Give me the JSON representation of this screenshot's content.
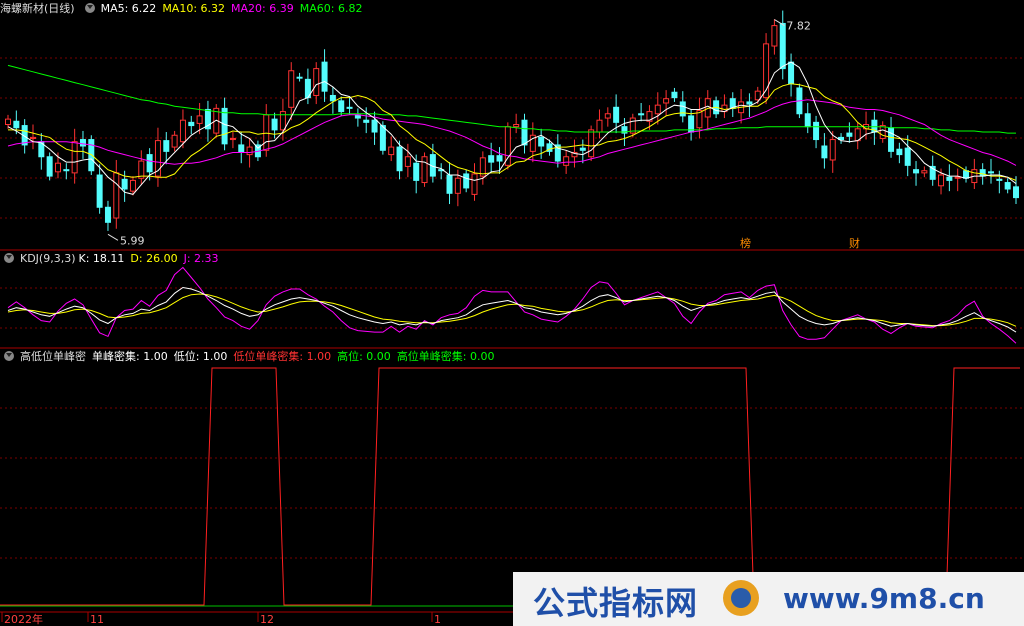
{
  "colors": {
    "up": "#ff3232",
    "down": "#54fcfc",
    "ma5": "#ffffff",
    "ma10": "#ffff00",
    "ma20": "#ff00ff",
    "ma60": "#00ff00",
    "k": "#ffffff",
    "d": "#ffff00",
    "j": "#ff00ff",
    "grid": "#7a0000",
    "signal": "#ff2020",
    "base": "#00c000"
  },
  "main": {
    "title": "海螺新材(日线)",
    "ma": [
      {
        "label": "MA5: 6.22",
        "color": "#ffffff"
      },
      {
        "label": "MA10: 6.32",
        "color": "#ffff00"
      },
      {
        "label": "MA20: 6.39",
        "color": "#ff00ff"
      },
      {
        "label": "MA60: 6.82",
        "color": "#00ff00"
      }
    ],
    "high_label": "7.82",
    "low_label": "5.99",
    "badge1": "榜",
    "badge2": "财"
  },
  "kdj": {
    "title": "KDJ(9,3,3)",
    "items": [
      {
        "label": "K: 18.11",
        "color": "#ffffff"
      },
      {
        "label": "D: 26.00",
        "color": "#ffff00"
      },
      {
        "label": "J: 2.33",
        "color": "#ff00ff"
      }
    ]
  },
  "ind": {
    "title": "高低位单峰密",
    "items": [
      {
        "label": "单峰密集: 1.00",
        "color": "#ffffff"
      },
      {
        "label": "低位: 1.00",
        "color": "#ffffff"
      },
      {
        "label": "低位单峰密集: 1.00",
        "color": "#ff3232"
      },
      {
        "label": "高位: 0.00",
        "color": "#00ff00"
      },
      {
        "label": "高位单峰密集: 0.00",
        "color": "#00ff00"
      }
    ]
  },
  "xaxis": {
    "labels": [
      "2022年",
      "11",
      "12",
      "1"
    ]
  },
  "watermark": {
    "text1": "公式指标网",
    "text2": "www.9m8.cn"
  },
  "chart_data": {
    "type": "candlestick",
    "price_range": [
      5.9,
      7.9
    ],
    "close": [
      6.95,
      6.87,
      6.71,
      6.78,
      6.6,
      6.42,
      6.54,
      6.47,
      6.74,
      6.7,
      6.47,
      6.13,
      5.99,
      6.45,
      6.3,
      6.38,
      6.56,
      6.46,
      6.75,
      6.65,
      6.8,
      6.94,
      6.89,
      6.98,
      6.86,
      7.05,
      6.72,
      6.77,
      6.64,
      6.69,
      6.6,
      6.99,
      6.85,
      7.02,
      7.4,
      7.34,
      7.15,
      7.42,
      7.21,
      7.12,
      7.02,
      7.05,
      6.96,
      6.92,
      6.83,
      6.66,
      6.69,
      6.47,
      6.6,
      6.38,
      6.6,
      6.42,
      6.47,
      6.26,
      6.4,
      6.31,
      6.44,
      6.59,
      6.55,
      6.56,
      6.88,
      6.9,
      6.71,
      6.8,
      6.7,
      6.65,
      6.56,
      6.6,
      6.64,
      6.66,
      6.85,
      6.94,
      7.0,
      6.92,
      6.82,
      6.96,
      6.99,
      7.02,
      7.08,
      7.14,
      7.15,
      6.98,
      6.83,
      7.03,
      7.14,
      7.0,
      7.08,
      7.05,
      7.11,
      7.09,
      7.21,
      7.65,
      7.82,
      7.42,
      7.28,
      7.0,
      6.88,
      6.76,
      6.59,
      6.76,
      6.76,
      6.79,
      6.86,
      6.9,
      6.83,
      6.89,
      6.65,
      6.62,
      6.52,
      6.45,
      6.47,
      6.39,
      6.43,
      6.38,
      6.41,
      6.4,
      6.48,
      6.42,
      6.45,
      6.38,
      6.3,
      6.22
    ],
    "ma5": [
      6.88,
      6.84,
      6.79,
      6.74,
      6.73,
      6.67,
      6.6,
      6.55,
      6.55,
      6.57,
      6.58,
      6.5,
      6.41,
      6.35,
      6.27,
      6.25,
      6.34,
      6.43,
      6.47,
      6.56,
      6.64,
      6.72,
      6.8,
      6.85,
      6.89,
      6.94,
      6.9,
      6.88,
      6.81,
      6.77,
      6.68,
      6.74,
      6.75,
      6.83,
      6.97,
      7.12,
      7.15,
      7.27,
      7.3,
      7.25,
      7.18,
      7.16,
      7.07,
      7.01,
      6.96,
      6.88,
      6.81,
      6.71,
      6.65,
      6.56,
      6.55,
      6.51,
      6.49,
      6.43,
      6.43,
      6.4,
      6.38,
      6.4,
      6.46,
      6.47,
      6.59,
      6.69,
      6.72,
      6.77,
      6.8,
      6.75,
      6.68,
      6.66,
      6.63,
      6.62,
      6.66,
      6.74,
      6.82,
      6.87,
      6.91,
      6.93,
      6.94,
      6.94,
      6.98,
      7.04,
      7.08,
      7.07,
      7.04,
      7.04,
      7.07,
      7.03,
      7.02,
      7.06,
      7.08,
      7.07,
      7.11,
      7.22,
      7.38,
      7.44,
      7.48,
      7.43,
      7.28,
      7.07,
      6.9,
      6.8,
      6.75,
      6.74,
      6.75,
      6.81,
      6.83,
      6.85,
      6.82,
      6.78,
      6.7,
      6.63,
      6.54,
      6.49,
      6.45,
      6.42,
      6.42,
      6.4,
      6.42,
      6.42,
      6.43,
      6.43,
      6.41,
      6.35
    ],
    "ma10": [
      6.85,
      6.85,
      6.84,
      6.82,
      6.8,
      6.78,
      6.72,
      6.67,
      6.65,
      6.65,
      6.62,
      6.55,
      6.48,
      6.45,
      6.42,
      6.41,
      6.42,
      6.42,
      6.41,
      6.41,
      6.44,
      6.53,
      6.61,
      6.66,
      6.72,
      6.79,
      6.81,
      6.84,
      6.83,
      6.83,
      6.81,
      6.82,
      6.81,
      6.82,
      6.87,
      6.9,
      6.95,
      7.01,
      7.06,
      7.11,
      7.15,
      7.15,
      7.17,
      7.15,
      7.11,
      7.03,
      6.99,
      6.89,
      6.83,
      6.76,
      6.72,
      6.66,
      6.6,
      6.54,
      6.5,
      6.48,
      6.45,
      6.44,
      6.45,
      6.45,
      6.5,
      6.55,
      6.56,
      6.61,
      6.63,
      6.67,
      6.69,
      6.69,
      6.7,
      6.71,
      6.7,
      6.71,
      6.74,
      6.75,
      6.77,
      6.8,
      6.84,
      6.88,
      6.93,
      6.98,
      7.0,
      7.01,
      7.0,
      7.01,
      7.05,
      7.06,
      7.04,
      7.05,
      7.06,
      7.07,
      7.07,
      7.12,
      7.22,
      7.26,
      7.28,
      7.27,
      7.25,
      7.23,
      7.16,
      7.12,
      7.09,
      7.01,
      6.92,
      6.86,
      6.85,
      6.8,
      6.78,
      6.77,
      6.76,
      6.73,
      6.69,
      6.65,
      6.61,
      6.56,
      6.52,
      6.47,
      6.45,
      6.44,
      6.42,
      6.42,
      6.41,
      6.38
    ],
    "ma20": [
      6.7,
      6.72,
      6.73,
      6.74,
      6.74,
      6.74,
      6.74,
      6.74,
      6.73,
      6.72,
      6.71,
      6.69,
      6.66,
      6.64,
      6.62,
      6.6,
      6.58,
      6.56,
      6.55,
      6.54,
      6.53,
      6.54,
      6.54,
      6.55,
      6.57,
      6.59,
      6.62,
      6.64,
      6.64,
      6.64,
      6.65,
      6.67,
      6.69,
      6.72,
      6.76,
      6.8,
      6.84,
      6.88,
      6.92,
      6.95,
      6.98,
      6.99,
      6.99,
      6.98,
      6.97,
      6.95,
      6.94,
      6.93,
      6.92,
      6.91,
      6.9,
      6.88,
      6.86,
      6.84,
      6.81,
      6.78,
      6.74,
      6.7,
      6.67,
      6.63,
      6.61,
      6.6,
      6.58,
      6.57,
      6.56,
      6.55,
      6.54,
      6.55,
      6.55,
      6.56,
      6.58,
      6.6,
      6.63,
      6.65,
      6.67,
      6.69,
      6.71,
      6.73,
      6.75,
      6.77,
      6.79,
      6.81,
      6.83,
      6.84,
      6.86,
      6.88,
      6.9,
      6.92,
      6.94,
      6.96,
      6.99,
      7.02,
      7.06,
      7.09,
      7.11,
      7.12,
      7.13,
      7.12,
      7.11,
      7.1,
      7.08,
      7.06,
      7.05,
      7.04,
      7.04,
      7.03,
      7.01,
      6.99,
      6.96,
      6.93,
      6.9,
      6.85,
      6.8,
      6.76,
      6.73,
      6.7,
      6.67,
      6.64,
      6.62,
      6.59,
      6.56,
      6.52
    ],
    "ma60": [
      7.45,
      7.43,
      7.41,
      7.39,
      7.37,
      7.35,
      7.33,
      7.31,
      7.29,
      7.27,
      7.25,
      7.23,
      7.21,
      7.19,
      7.17,
      7.15,
      7.13,
      7.12,
      7.1,
      7.09,
      7.07,
      7.06,
      7.05,
      7.04,
      7.03,
      7.02,
      7.01,
      7.01,
      7.0,
      7.0,
      7.0,
      6.99,
      6.99,
      6.99,
      6.99,
      6.99,
      6.99,
      6.99,
      6.99,
      6.99,
      7.0,
      7.0,
      7.0,
      7.0,
      7.0,
      6.99,
      6.99,
      6.99,
      6.98,
      6.98,
      6.97,
      6.96,
      6.95,
      6.94,
      6.93,
      6.92,
      6.91,
      6.9,
      6.89,
      6.88,
      6.88,
      6.87,
      6.86,
      6.86,
      6.85,
      6.85,
      6.84,
      6.84,
      6.83,
      6.83,
      6.83,
      6.83,
      6.83,
      6.83,
      6.83,
      6.84,
      6.84,
      6.84,
      6.84,
      6.84,
      6.85,
      6.85,
      6.85,
      6.85,
      6.85,
      6.86,
      6.86,
      6.86,
      6.87,
      6.87,
      6.87,
      6.88,
      6.88,
      6.88,
      6.88,
      6.88,
      6.88,
      6.88,
      6.88,
      6.88,
      6.88,
      6.88,
      6.88,
      6.88,
      6.88,
      6.88,
      6.87,
      6.87,
      6.87,
      6.87,
      6.86,
      6.86,
      6.85,
      6.85,
      6.84,
      6.84,
      6.84,
      6.83,
      6.83,
      6.83,
      6.82,
      6.82
    ],
    "kdj_k": [
      48,
      52,
      50,
      46,
      42,
      40,
      45,
      50,
      54,
      52,
      44,
      35,
      30,
      38,
      42,
      44,
      50,
      48,
      55,
      60,
      72,
      80,
      78,
      74,
      68,
      62,
      55,
      50,
      44,
      40,
      42,
      50,
      56,
      60,
      64,
      66,
      64,
      62,
      58,
      54,
      48,
      42,
      38,
      35,
      32,
      30,
      32,
      28,
      30,
      28,
      32,
      30,
      34,
      36,
      38,
      42,
      50,
      56,
      58,
      60,
      62,
      58,
      52,
      50,
      46,
      44,
      42,
      44,
      48,
      54,
      62,
      68,
      70,
      66,
      60,
      62,
      64,
      66,
      68,
      66,
      62,
      54,
      48,
      52,
      56,
      58,
      62,
      64,
      66,
      64,
      68,
      72,
      74,
      60,
      50,
      40,
      34,
      30,
      28,
      30,
      34,
      36,
      38,
      36,
      34,
      30,
      26,
      28,
      30,
      28,
      27,
      26,
      28,
      30,
      34,
      40,
      45,
      38,
      34,
      30,
      25,
      18
    ],
    "kdj_d": [
      46,
      48,
      49,
      48,
      46,
      44,
      44,
      46,
      49,
      50,
      48,
      44,
      39,
      38,
      39,
      41,
      44,
      45,
      48,
      52,
      59,
      66,
      70,
      71,
      70,
      67,
      63,
      58,
      53,
      49,
      46,
      47,
      50,
      53,
      57,
      60,
      61,
      61,
      60,
      58,
      55,
      51,
      47,
      43,
      39,
      36,
      35,
      33,
      32,
      31,
      31,
      31,
      32,
      33,
      35,
      37,
      41,
      46,
      50,
      53,
      56,
      57,
      55,
      54,
      51,
      49,
      47,
      46,
      47,
      49,
      53,
      58,
      62,
      63,
      62,
      62,
      63,
      64,
      65,
      66,
      64,
      61,
      57,
      55,
      55,
      56,
      58,
      60,
      62,
      63,
      64,
      67,
      69,
      66,
      61,
      54,
      47,
      41,
      37,
      34,
      34,
      35,
      36,
      36,
      35,
      34,
      31,
      30,
      30,
      29,
      28,
      27,
      27,
      28,
      30,
      33,
      37,
      37,
      36,
      34,
      31,
      26
    ],
    "kdj_j": [
      52,
      60,
      52,
      42,
      34,
      32,
      47,
      58,
      64,
      56,
      36,
      17,
      12,
      38,
      48,
      50,
      62,
      54,
      69,
      76,
      98,
      108,
      94,
      80,
      64,
      52,
      39,
      34,
      26,
      22,
      34,
      56,
      68,
      74,
      78,
      78,
      70,
      64,
      54,
      46,
      34,
      24,
      20,
      19,
      18,
      18,
      26,
      18,
      26,
      22,
      34,
      28,
      38,
      42,
      44,
      52,
      68,
      76,
      74,
      74,
      74,
      60,
      46,
      42,
      36,
      34,
      32,
      40,
      50,
      64,
      80,
      88,
      86,
      72,
      56,
      62,
      66,
      70,
      74,
      66,
      58,
      40,
      30,
      46,
      58,
      62,
      70,
      72,
      74,
      66,
      76,
      82,
      84,
      48,
      28,
      12,
      8,
      8,
      10,
      22,
      34,
      38,
      42,
      36,
      32,
      22,
      16,
      24,
      30,
      26,
      25,
      24,
      30,
      34,
      42,
      54,
      61,
      40,
      30,
      22,
      13,
      2.33
    ],
    "signal": {
      "values": [
        0,
        1,
        0,
        1,
        0,
        1
      ],
      "segments_x": [
        0,
        208,
        280,
        375,
        750,
        950,
        1024
      ]
    }
  }
}
